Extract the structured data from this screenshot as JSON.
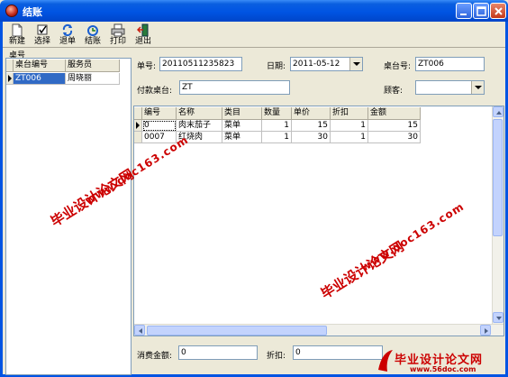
{
  "window": {
    "title": "结账"
  },
  "toolbar": [
    {
      "label": "新建",
      "icon": "new-doc-icon"
    },
    {
      "label": "选择",
      "icon": "checkbox-icon"
    },
    {
      "label": "退单",
      "icon": "refresh-icon"
    },
    {
      "label": "结账",
      "icon": "checkout-icon"
    },
    {
      "label": "打印",
      "icon": "printer-icon"
    },
    {
      "label": "退出",
      "icon": "exit-icon"
    }
  ],
  "left": {
    "group_label": "桌号",
    "columns": [
      "桌台编号",
      "服务员"
    ],
    "rows": [
      {
        "table_no": "ZT006",
        "waiter": "周晓丽"
      }
    ]
  },
  "form": {
    "order_no_label": "单号:",
    "order_no": "20110511235823",
    "date_label": "日期:",
    "date": "2011-05-12",
    "table_no_label": "桌台号:",
    "table_no": "ZT006",
    "pay_table_label": "付款桌台:",
    "pay_table": "ZT",
    "customer_label": "顾客:",
    "customer": ""
  },
  "grid": {
    "columns": [
      "编号",
      "名称",
      "类目",
      "数量",
      "单价",
      "折扣",
      "金额"
    ],
    "rows": [
      {
        "id": "0",
        "name": "肉末茄子",
        "category": "菜单",
        "qty": "1",
        "price": "15",
        "discount": "1",
        "amount": "15"
      },
      {
        "id": "0007",
        "name": "红烧肉",
        "category": "菜单",
        "qty": "1",
        "price": "30",
        "discount": "1",
        "amount": "30"
      }
    ]
  },
  "footer": {
    "consume_label": "消费金额:",
    "consume_value": "0",
    "discount_label": "折扣:",
    "discount_value": "0"
  },
  "watermark": {
    "cn": "毕业设计论文网",
    "url": "www.doc163.com",
    "logo_cn": "毕业设计论文网",
    "logo_url": "www.56doc.com"
  },
  "colors": {
    "titlebar": "#0054e3",
    "watermark": "#cc0000",
    "face": "#ece9d8"
  }
}
